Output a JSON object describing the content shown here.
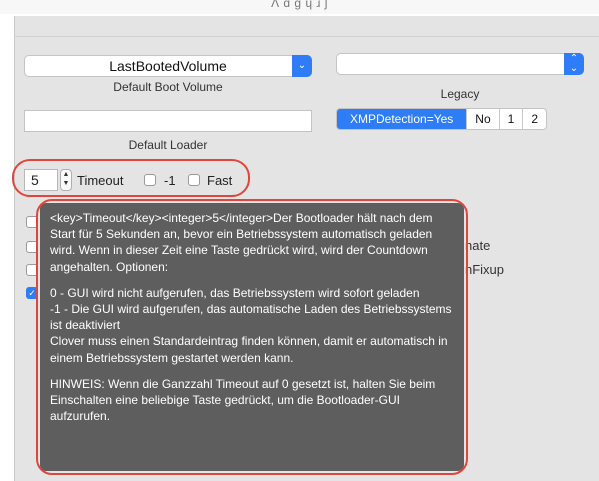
{
  "header": {
    "cut_title": "Ʌ  ɑ ɡ  ɥ  ɹ  ʃ"
  },
  "boot_volume": {
    "selected": "LastBootedVolume",
    "caption": "Default Boot Volume"
  },
  "legacy": {
    "selected": "",
    "caption": "Legacy"
  },
  "loader": {
    "value": "",
    "caption": "Default Loader"
  },
  "xmp": {
    "options": [
      "XMPDetection=Yes",
      "No",
      "1",
      "2"
    ],
    "selected": "XMPDetection=Yes"
  },
  "timeout": {
    "value": "5",
    "label": "Timeout",
    "minus_one_label": "-1",
    "fast_label": "Fast",
    "minus_one_checked": false,
    "fast_checked": false
  },
  "hidden_options": {
    "partial_1": "nate",
    "partial_2": "nFixup"
  },
  "tooltip": {
    "para1": "<key>Timeout</key><integer>5</integer>Der Bootloader hält nach dem Start für 5 Sekunden an, bevor ein Betriebssystem automatisch geladen wird. Wenn in dieser Zeit eine Taste gedrückt wird, wird der Countdown angehalten. Optionen:",
    "para2": "0 - GUI wird nicht aufgerufen, das Betriebssystem wird sofort geladen\n-1 - Die GUI wird aufgerufen, das automatische Laden des Betriebssystems ist deaktiviert\nClover muss einen Standardeintrag finden können, damit er automatisch in einem Betriebssystem gestartet werden kann.",
    "para3": "HINWEIS: Wenn die Ganzzahl Timeout auf 0 gesetzt ist, halten Sie beim Einschalten eine beliebige Taste gedrückt, um die Bootloader-GUI aufzurufen."
  },
  "colors": {
    "accent": "#2f7df6",
    "highlight_ring": "#e0463c",
    "tooltip_bg": "#585858",
    "panel_bg": "#e4e4e4"
  }
}
